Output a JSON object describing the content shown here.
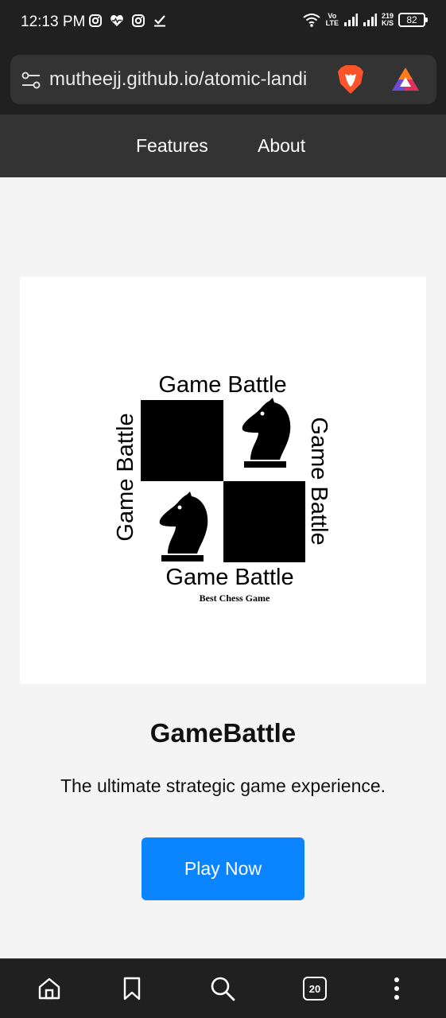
{
  "status_bar": {
    "time": "12:13 PM",
    "net_speed_value": "219",
    "net_speed_unit": "K/S",
    "volte_top": "Vo",
    "volte_bottom": "LTE",
    "battery": "82",
    "left_icons": [
      "instagram-icon",
      "heart-pulse-icon",
      "instagram-icon",
      "download-done-icon"
    ],
    "right_icons": [
      "wifi-icon",
      "signal-icon",
      "signal-icon"
    ]
  },
  "browser": {
    "url": "mutheejj.github.io/atomic-landi",
    "tabs_count": "20",
    "toolbar_icons": [
      "home-icon",
      "bookmark-icon",
      "search-icon",
      "tabs-icon",
      "more-vert-icon"
    ]
  },
  "site_nav": {
    "links": [
      {
        "label": "Features"
      },
      {
        "label": "About"
      }
    ]
  },
  "hero": {
    "logo_text": "Game Battle",
    "logo_tagline": "Best Chess Game",
    "title": "GameBattle",
    "subtitle": "The ultimate strategic game experience.",
    "cta_label": "Play Now"
  },
  "colors": {
    "status_bg": "#202020",
    "nav_bg": "#333333",
    "page_bg": "#f4f4f4",
    "cta": "#0a84ff"
  }
}
